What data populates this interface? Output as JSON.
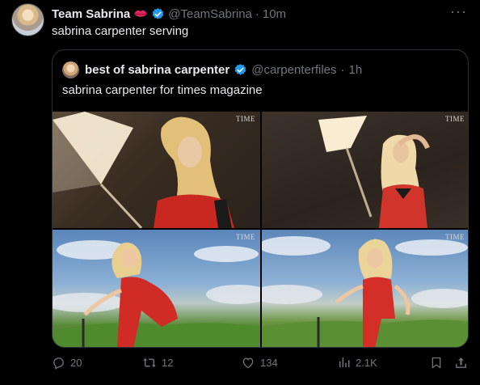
{
  "tweet": {
    "author_name": "Team Sabrina",
    "handle": "@TeamSabrina",
    "separator": "·",
    "time": "10m",
    "text": "sabrina carpenter serving",
    "more": "···"
  },
  "quote": {
    "author_name": "best of sabrina carpenter",
    "handle": "@carpenterfiles",
    "separator": "·",
    "time": "1h",
    "text": "sabrina carpenter for times magazine",
    "photos": [
      {
        "watermark": "TIME"
      },
      {
        "watermark": "TIME"
      },
      {
        "watermark": "TIME"
      },
      {
        "watermark": "TIME"
      }
    ]
  },
  "actions": {
    "replies": "20",
    "reposts": "12",
    "likes": "134",
    "views": "2.1K"
  },
  "icons": {
    "verified": "verified-badge-icon",
    "lips": "lips-emoji-icon",
    "reply": "reply-icon",
    "repost": "repost-icon",
    "like": "heart-icon",
    "views": "views-chart-icon",
    "bookmark": "bookmark-icon",
    "share": "share-icon"
  },
  "colors": {
    "background": "#000000",
    "text": "#e7e9ea",
    "muted": "#71767b",
    "verified": "#1d9bf0",
    "border": "#2f3336"
  }
}
